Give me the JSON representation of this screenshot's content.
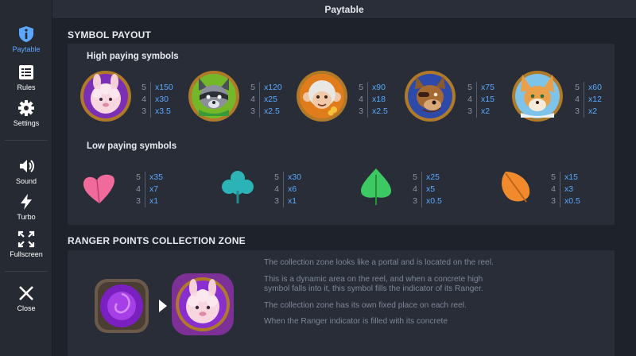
{
  "sidebar": {
    "items": [
      {
        "label": "Paytable"
      },
      {
        "label": "Rules"
      },
      {
        "label": "Settings"
      },
      {
        "label": "Sound"
      },
      {
        "label": "Turbo"
      },
      {
        "label": "Fullscreen"
      },
      {
        "label": "Close"
      }
    ],
    "active_color": "#5aa8ff"
  },
  "header": {
    "title": "Paytable"
  },
  "symbol_payout": {
    "title": "SYMBOL PAYOUT",
    "high_title": "High paying symbols",
    "low_title": "Low paying symbols",
    "high": [
      {
        "name": "sheep",
        "rows": [
          {
            "count": "5",
            "mult": "x150"
          },
          {
            "count": "4",
            "mult": "x30"
          },
          {
            "count": "3",
            "mult": "x3.5"
          }
        ]
      },
      {
        "name": "raccoon",
        "rows": [
          {
            "count": "5",
            "mult": "x120"
          },
          {
            "count": "4",
            "mult": "x25"
          },
          {
            "count": "3",
            "mult": "x2.5"
          }
        ]
      },
      {
        "name": "monkey",
        "rows": [
          {
            "count": "5",
            "mult": "x90"
          },
          {
            "count": "4",
            "mult": "x18"
          },
          {
            "count": "3",
            "mult": "x2.5"
          }
        ]
      },
      {
        "name": "wolf",
        "rows": [
          {
            "count": "5",
            "mult": "x75"
          },
          {
            "count": "4",
            "mult": "x15"
          },
          {
            "count": "3",
            "mult": "x2"
          }
        ]
      },
      {
        "name": "fox",
        "rows": [
          {
            "count": "5",
            "mult": "x60"
          },
          {
            "count": "4",
            "mult": "x12"
          },
          {
            "count": "3",
            "mult": "x2"
          }
        ]
      }
    ],
    "low": [
      {
        "name": "pink-leaf",
        "color": "#f06a9c",
        "rows": [
          {
            "count": "5",
            "mult": "x35"
          },
          {
            "count": "4",
            "mult": "x7"
          },
          {
            "count": "3",
            "mult": "x1"
          }
        ]
      },
      {
        "name": "teal-leaf",
        "color": "#2bb3b5",
        "rows": [
          {
            "count": "5",
            "mult": "x30"
          },
          {
            "count": "4",
            "mult": "x6"
          },
          {
            "count": "3",
            "mult": "x1"
          }
        ]
      },
      {
        "name": "green-leaf",
        "color": "#3cc964",
        "rows": [
          {
            "count": "5",
            "mult": "x25"
          },
          {
            "count": "4",
            "mult": "x5"
          },
          {
            "count": "3",
            "mult": "x0.5"
          }
        ]
      },
      {
        "name": "orange-leaf",
        "color": "#f08a2c",
        "rows": [
          {
            "count": "5",
            "mult": "x15"
          },
          {
            "count": "4",
            "mult": "x3"
          },
          {
            "count": "3",
            "mult": "x0.5"
          }
        ]
      }
    ]
  },
  "collection_zone": {
    "title": "RANGER POINTS COLLECTION ZONE",
    "paragraphs": [
      "The collection zone looks like a portal and is located on the reel.",
      "This is a dynamic area on the reel, and when a concrete high symbol falls into it, this symbol fills the indicator of its Ranger.",
      "The collection zone has its own fixed place on each reel.",
      "When the Ranger indicator is filled with its concrete"
    ]
  }
}
